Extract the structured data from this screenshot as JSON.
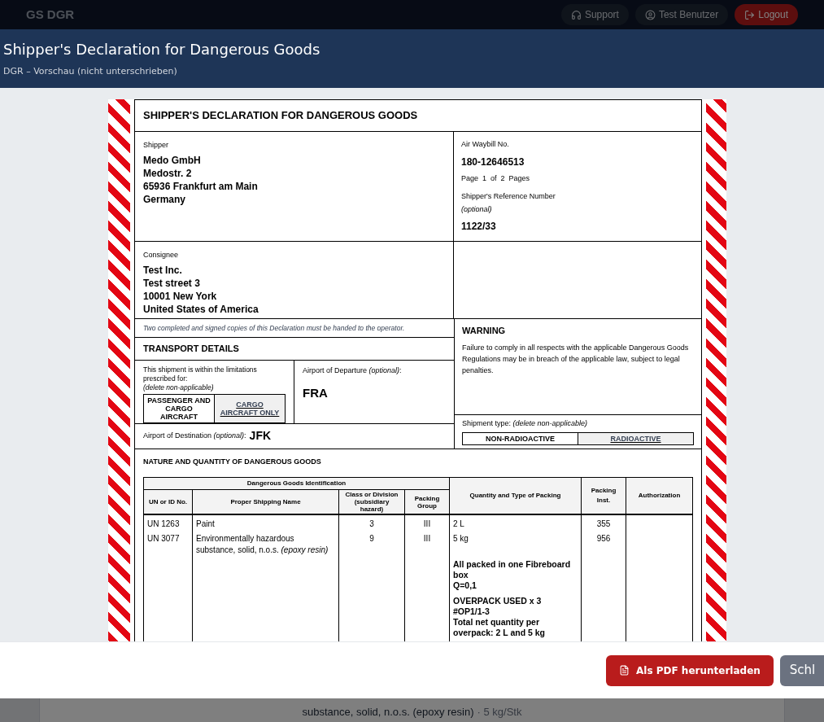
{
  "nav": {
    "brand": "GS DGR",
    "buttons": [
      {
        "kind": "support",
        "label": "Support"
      },
      {
        "kind": "user",
        "label": "Test Benutzer"
      },
      {
        "kind": "logout",
        "label": "Logout"
      }
    ]
  },
  "background_card": {
    "text": "substance, solid, n.o.s. (epoxy resin)",
    "detail": "· 5 kg/Stk"
  },
  "modal": {
    "title": "Shipper's Declaration for Dangerous Goods",
    "subtitle": "DGR – Vorschau (nicht unterschrieben)"
  },
  "document": {
    "title": "SHIPPER'S DECLARATION FOR DANGEROUS GOODS",
    "shipper": {
      "label": "Shipper",
      "lines": [
        "Medo GmbH",
        "Medostr. 2",
        "65936 Frankfurt am Main",
        "Germany"
      ]
    },
    "air_waybill": {
      "label": "Air Waybill No.",
      "value": "180-12646513",
      "page": "Page  1  of  2  Pages",
      "reference_label": "Shipper's Reference Number",
      "reference_hint": "(optional)",
      "reference": "1122/33"
    },
    "consignee": {
      "label": "Consignee",
      "lines": [
        "Test Inc.",
        "Test street 3",
        "10001 New York",
        "United States of America"
      ]
    },
    "notice": "Two completed and signed copies of this Declaration must be handed to the operator.",
    "transport": {
      "heading": "TRANSPORT DETAILS",
      "limitation": "This shipment is within the limitations prescribed for:",
      "hint": "(delete non-applicable)",
      "options": [
        {
          "label": "PASSENGER AND CARGO AIRCRAFT",
          "deleted": false
        },
        {
          "label": "CARGO AIRCRAFT ONLY",
          "deleted": true
        }
      ],
      "departure_label": "Airport of Departure *(optional)*:",
      "departure": "FRA",
      "destination_label": "Airport of Destination *(optional)*:",
      "destination": "JFK"
    },
    "warning": {
      "heading": "WARNING",
      "text": "Failure to comply in all respects with the applicable Dangerous Goods Regulations may be in breach of the applicable law, subject to legal penalties."
    },
    "shipment_type": {
      "label": "Shipment type: *(delete non-applicable)*",
      "options": [
        {
          "label": "NON-RADIOACTIVE",
          "deleted": false
        },
        {
          "label": "RADIOACTIVE",
          "deleted": true
        }
      ]
    },
    "nature_heading": "NATURE AND QUANTITY OF DANGEROUS GOODS",
    "table": {
      "group_header": "Dangerous Goods Identification",
      "columns": [
        "UN or ID No.",
        "Proper Shipping Name",
        "Class or Division (subsidiary hazard)",
        "Packing Group",
        "Quantity and Type of Packing",
        "Packing Inst.",
        "Authorization"
      ],
      "rows": [
        [
          "UN 1263",
          "Paint",
          "3",
          "III",
          "2 L",
          "355"
        ],
        [
          "UN 3077",
          "Environmentally hazardous substance, solid, n.o.s. *(epoxy resin)*",
          "9",
          "III",
          "5 kg",
          "956"
        ]
      ],
      "notes": [
        [
          "All packed in one Fibreboard box",
          "Q=0,1"
        ],
        [
          "OVERPACK USED x 3",
          "#OP1/1-3",
          "Total net quantity per overpack: 2 L and 5 kg"
        ]
      ]
    }
  },
  "footer": {
    "buttons": [
      {
        "kind": "pdf",
        "label": "Als PDF herunterladen"
      },
      {
        "kind": "close",
        "label": "Schl"
      }
    ]
  }
}
